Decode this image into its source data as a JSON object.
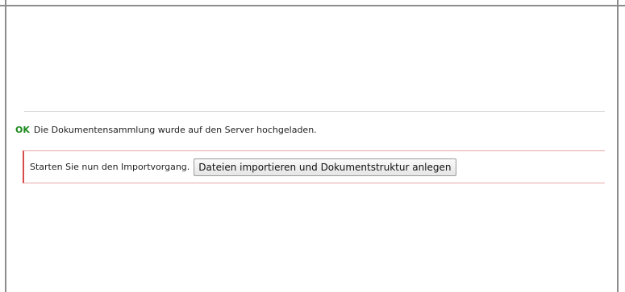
{
  "status": {
    "ok_label": "OK",
    "message": "Die Dokumentensammlung wurde auf den Server hochgeladen."
  },
  "import": {
    "prompt": "Starten Sie nun den Importvorgang.",
    "button_label": "Dateien importieren und Dokumentstruktur anlegen"
  },
  "colors": {
    "ok": "#1d8a1d",
    "box_border_left": "#d94a4a",
    "box_border": "#e8a8a8",
    "frame": "#8c8c8c"
  }
}
